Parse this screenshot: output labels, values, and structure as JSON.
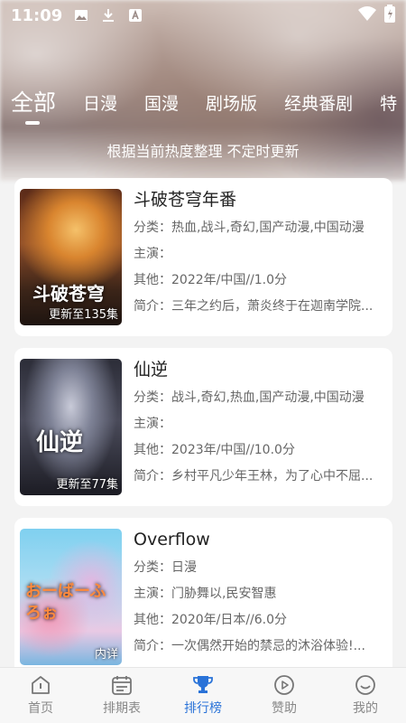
{
  "status_bar": {
    "time": "11:09"
  },
  "tabs": [
    "全部",
    "日漫",
    "国漫",
    "剧场版",
    "经典番剧",
    "特"
  ],
  "subtitle": "根据当前热度整理 不定时更新",
  "items": [
    {
      "title": "斗破苍穹年番",
      "category": "分类：热血,战斗,奇幻,国产动漫,中国动漫",
      "cast": "主演：",
      "other": "其他：2022年/中国//1.0分",
      "intro": "简介：三年之约后，萧炎终于在迦南学院...",
      "badge": "更新至135集",
      "poster_text": "斗破苍穹"
    },
    {
      "title": "仙逆",
      "category": "分类：战斗,奇幻,热血,国产动漫,中国动漫",
      "cast": "主演：",
      "other": "其他：2023年/中国//10.0分",
      "intro": "简介：乡村平凡少年王林，为了心中不屈...",
      "badge": "更新至77集",
      "poster_text": "仙逆"
    },
    {
      "title": "Overflow",
      "category": "分类：日漫",
      "cast": "主演：门胁舞以,民安智惠",
      "other": "其他：2020年/日本//6.0分",
      "intro": "简介：一次偶然开始的禁忌的沐浴体验!...",
      "badge": "内详",
      "poster_text": "おーばーふろぉ"
    }
  ],
  "bottom_nav": [
    {
      "label": "首页",
      "icon": "home-icon"
    },
    {
      "label": "排期表",
      "icon": "calendar-icon"
    },
    {
      "label": "排行榜",
      "icon": "trophy-icon"
    },
    {
      "label": "赞助",
      "icon": "play-circle-icon"
    },
    {
      "label": "我的",
      "icon": "smile-icon"
    }
  ],
  "colors": {
    "accent": "#2a73d8",
    "card_bg": "#ffffff",
    "page_bg": "#f3f3f3"
  }
}
